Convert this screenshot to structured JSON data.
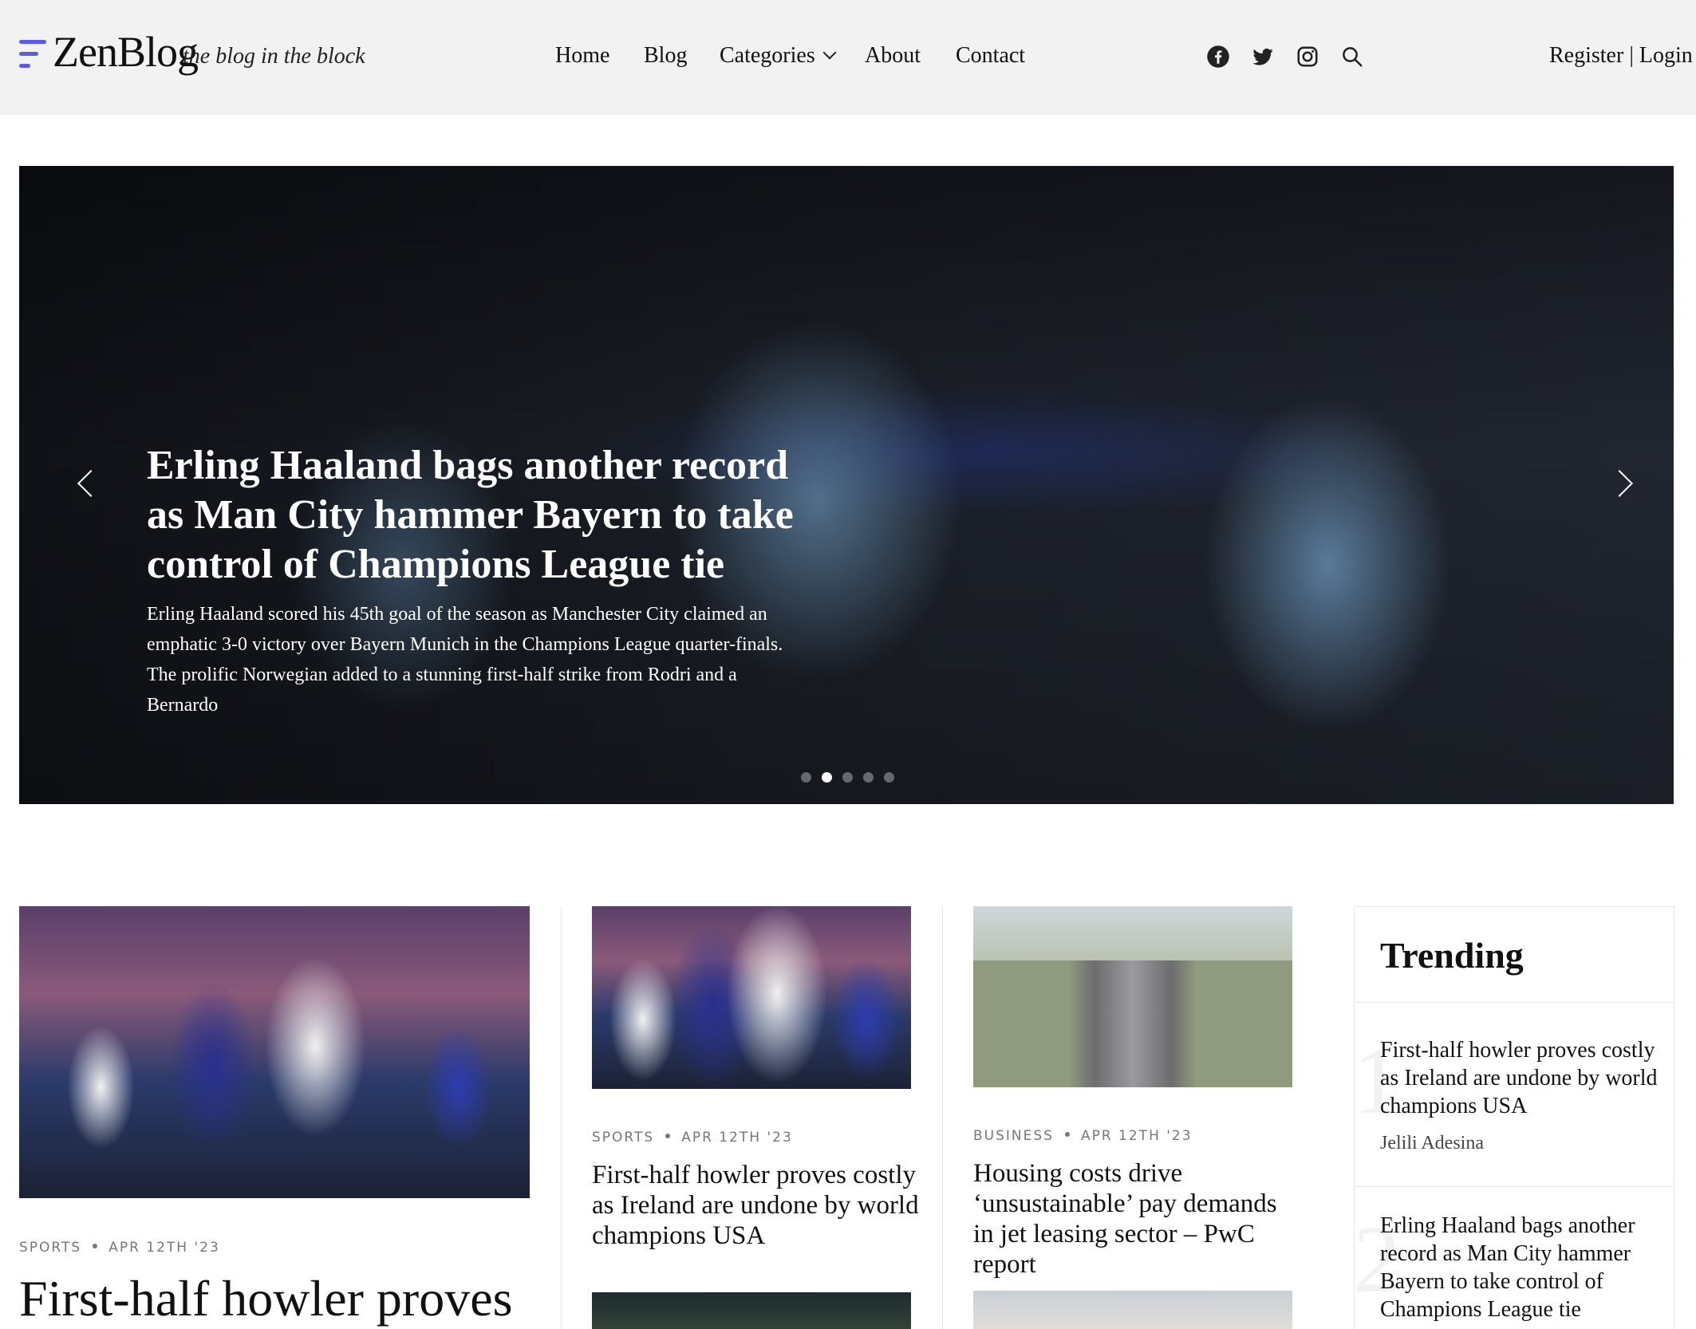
{
  "brand": {
    "name": "ZenBlog",
    "tagline": "the blog in the block",
    "bar_colors": [
      "#5b5be8",
      "#5b5be8",
      "#5b5be8"
    ]
  },
  "nav": {
    "items": [
      {
        "label": "Home"
      },
      {
        "label": "Blog"
      },
      {
        "label": "Categories"
      },
      {
        "label": "About"
      },
      {
        "label": "Contact"
      }
    ],
    "social_icons": [
      "facebook-icon",
      "twitter-icon",
      "instagram-icon",
      "search-icon"
    ],
    "auth": {
      "register": "Register",
      "separator": "|",
      "login": "Login"
    }
  },
  "hero": {
    "title": "Erling Haaland bags another record as Man City hammer Bayern to take control of Champions League tie",
    "excerpt": "Erling Haaland scored his 45th goal of the season as Manchester City claimed an emphatic 3-0 victory over Bayern Munich in the Champions League quarter-finals. The prolific Norwegian added to a stunning first-half strike from Rodri and a Bernardo",
    "slide_count": 5,
    "active_slide": 1
  },
  "articles": {
    "featured": {
      "category": "SPORTS",
      "date": "APR 12TH '23",
      "title": "First-half howler proves"
    },
    "col2": {
      "category": "SPORTS",
      "date": "APR 12TH '23",
      "title": "First-half howler proves costly as Ireland are undone by world champions USA"
    },
    "col3": {
      "category": "BUSINESS",
      "date": "APR 12TH '23",
      "title": "Housing costs drive ‘unsustainable’ pay demands in jet leasing sector – PwC report"
    }
  },
  "trending": {
    "heading": "Trending",
    "items": [
      {
        "rank": "1",
        "title": "First-half howler proves costly as Ireland are undone by world champions USA",
        "author": "Jelili Adesina"
      },
      {
        "rank": "2",
        "title": "Erling Haaland bags another record as Man City hammer Bayern to take control of Champions League tie"
      }
    ]
  }
}
